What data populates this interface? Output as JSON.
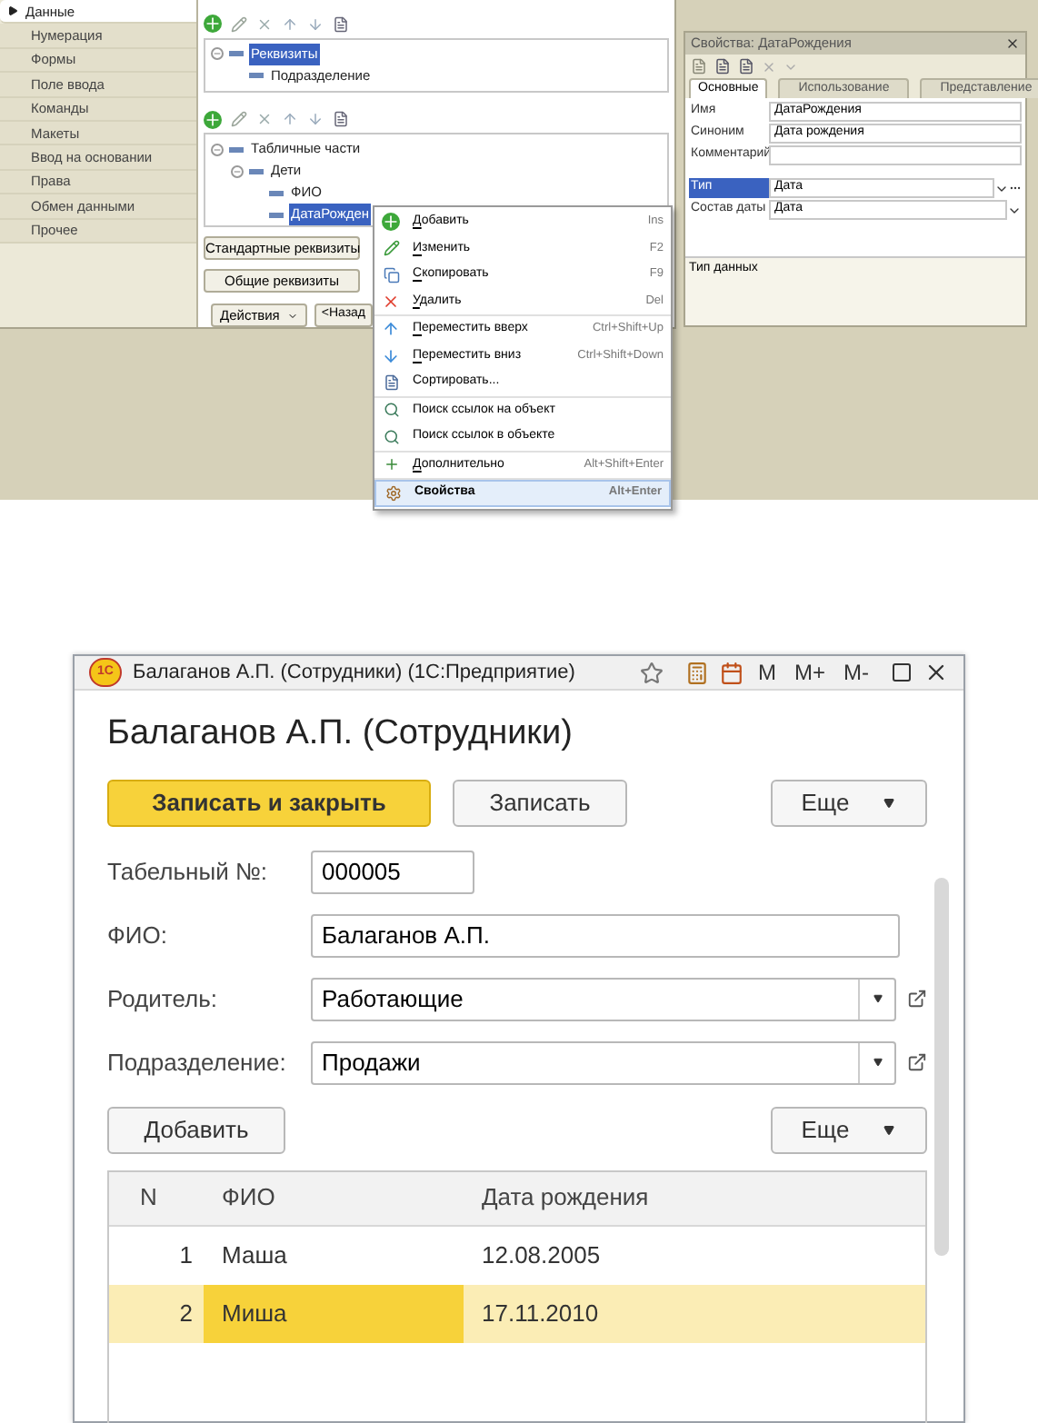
{
  "configurator": {
    "sidebar": [
      {
        "label": "Данные",
        "selected": true
      },
      {
        "label": "Нумерация",
        "selected": false
      },
      {
        "label": "Формы",
        "selected": false
      },
      {
        "label": "Поле ввода",
        "selected": false
      },
      {
        "label": "Команды",
        "selected": false
      },
      {
        "label": "Макеты",
        "selected": false
      },
      {
        "label": "Ввод на основании",
        "selected": false
      },
      {
        "label": "Права",
        "selected": false
      },
      {
        "label": "Обмен данными",
        "selected": false
      },
      {
        "label": "Прочее",
        "selected": false
      }
    ],
    "attributes_tree": [
      {
        "label": "Реквизиты",
        "selected": true,
        "expanded": true,
        "children": [
          {
            "label": "Подразделение",
            "selected": false
          }
        ]
      }
    ],
    "tables_tree": [
      {
        "label": "Табличные части",
        "selected": false,
        "expanded": true,
        "children": [
          {
            "label": "Дети",
            "selected": false,
            "expanded": true,
            "children": [
              {
                "label": "ФИО",
                "selected": false
              },
              {
                "label": "ДатаРожден",
                "selected": true
              }
            ]
          }
        ]
      }
    ],
    "standard_button": "Стандартные реквизиты",
    "common_button": "Общие реквизиты",
    "actions_button": "Действия",
    "back_button": "<Назад"
  },
  "context_menu": {
    "groups": [
      [
        {
          "label": "Добавить",
          "shortcut": "Ins",
          "underlined": true,
          "selected": false
        },
        {
          "label": "Изменить",
          "shortcut": "F2",
          "underlined": true,
          "selected": false
        },
        {
          "label": "Скопировать",
          "shortcut": "F9",
          "underlined": true,
          "selected": false
        },
        {
          "label": "Удалить",
          "shortcut": "Del",
          "underlined": true,
          "selected": false
        }
      ],
      [
        {
          "label": "Переместить вверх",
          "shortcut": "Ctrl+Shift+Up",
          "underlined": true,
          "selected": false
        },
        {
          "label": "Переместить вниз",
          "shortcut": "Ctrl+Shift+Down",
          "underlined": true,
          "selected": false
        },
        {
          "label": "Сортировать...",
          "underlined": false,
          "selected": false
        }
      ],
      [
        {
          "label": "Поиск ссылок на объект",
          "underlined": false,
          "selected": false
        },
        {
          "label": "Поиск ссылок в объекте",
          "underlined": false,
          "selected": false
        }
      ],
      [
        {
          "label": "Дополнительно",
          "shortcut": "Alt+Shift+Enter",
          "underlined": true,
          "selected": false
        }
      ],
      [
        {
          "label": "Свойства",
          "shortcut": "Alt+Enter",
          "underlined": false,
          "selected": true
        }
      ]
    ]
  },
  "properties": {
    "title": "Свойства: ДатаРождения",
    "tabs": [
      {
        "label": "Основные",
        "selected": true
      },
      {
        "label": "Использование",
        "selected": false
      },
      {
        "label": "Представление",
        "selected": false
      }
    ],
    "fields": [
      {
        "label": "Имя",
        "value": "ДатаРождения",
        "kind": "text",
        "selected": false
      },
      {
        "label": "Синоним",
        "value": "Дата рождения",
        "kind": "text",
        "selected": false
      },
      {
        "label": "Комментарий",
        "kind": "text",
        "selected": false
      },
      {
        "label": "Тип",
        "value": "Дата",
        "kind": "type",
        "selected": true
      },
      {
        "label": "Состав даты",
        "value": "Дата",
        "kind": "select",
        "selected": false
      }
    ],
    "hint": "Тип данных"
  },
  "window": {
    "title": "Балаганов А.П. (Сотрудники) (1С:Предприятие)",
    "logo": "1С",
    "memory_buttons": [
      "M",
      "M+",
      "M-"
    ]
  },
  "form": {
    "heading": "Балаганов А.П. (Сотрудники)",
    "save_close_button": "Записать и закрыть",
    "save_button": "Записать",
    "more_button": "Еще",
    "fields": [
      {
        "label": "Табельный №:",
        "value": "000005",
        "kind": "short"
      },
      {
        "label": "ФИО:",
        "value": "Балаганов А.П.",
        "kind": "text"
      },
      {
        "label": "Родитель:",
        "value": "Работающие",
        "kind": "select"
      },
      {
        "label": "Подразделение:",
        "value": "Продажи",
        "kind": "select"
      }
    ],
    "add_button": "Добавить",
    "table_more_button": "Еще",
    "table": {
      "columns": [
        "N",
        "ФИО",
        "Дата рождения"
      ],
      "rows": [
        {
          "selected": false,
          "cells": [
            {
              "text": "1",
              "focused": false
            },
            {
              "text": "Маша",
              "focused": false
            },
            {
              "text": "12.08.2005",
              "focused": false
            }
          ]
        },
        {
          "selected": true,
          "cells": [
            {
              "text": "2",
              "focused": false
            },
            {
              "text": "Миша",
              "focused": true
            },
            {
              "text": "17.11.2010",
              "focused": false
            }
          ]
        }
      ]
    }
  }
}
